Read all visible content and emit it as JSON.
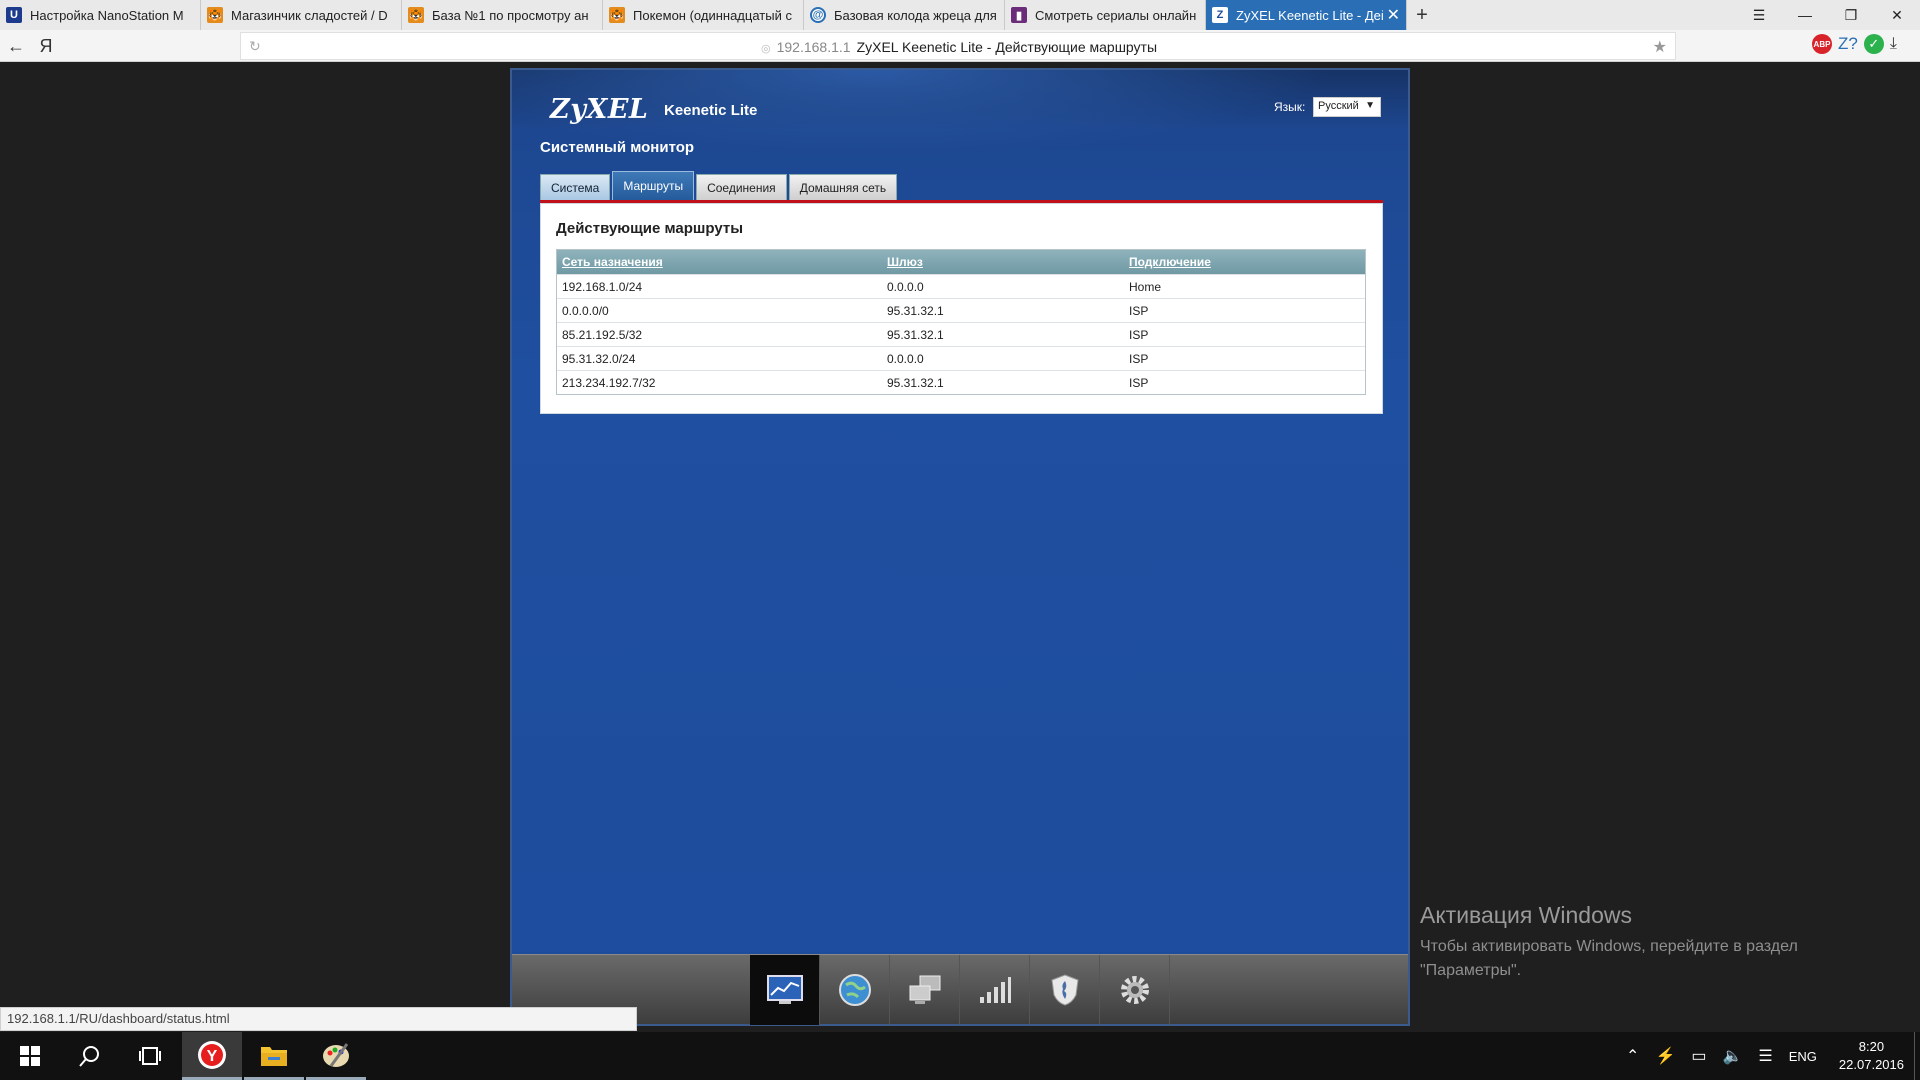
{
  "browser": {
    "tabs": [
      {
        "label": "Настройка NanoStation M",
        "icon": "ubiquiti-icon",
        "color": "#1d3b8c"
      },
      {
        "label": "Магазинчик сладостей / D",
        "icon": "tiger-icon",
        "color": "#e38b1c"
      },
      {
        "label": "База №1 по просмотру ан",
        "icon": "tiger-icon",
        "color": "#e38b1c"
      },
      {
        "label": "Покемон (одиннадцатый с",
        "icon": "tiger-icon",
        "color": "#e38b1c"
      },
      {
        "label": "Базовая колода жреца для",
        "icon": "spiral-icon",
        "color": "#2a6fb5"
      },
      {
        "label": "Смотреть сериалы онлайн",
        "icon": "book-icon",
        "color": "#6b2d7a"
      },
      {
        "label": "ZyXEL Keenetic Lite - Дей",
        "icon": "zyxel-icon",
        "color": "#1e4c9d"
      }
    ],
    "address": {
      "host": "192.168.1.1",
      "title": "ZyXEL Keenetic Lite - Действующие маршруты"
    },
    "status_url": "192.168.1.1/RU/dashboard/status.html"
  },
  "router": {
    "brand": "ZyXEL",
    "model": "Keenetic Lite",
    "language_label": "Язык:",
    "language_value": "Русский",
    "page_title": "Системный монитор",
    "tabs": [
      "Система",
      "Маршруты",
      "Соединения",
      "Домашняя сеть"
    ],
    "active_tab": "Маршруты",
    "panel_title": "Действующие маршруты",
    "table": {
      "headers": [
        "Сеть назначения",
        "Шлюз",
        "Подключение"
      ],
      "rows": [
        [
          "192.168.1.0/24",
          "0.0.0.0",
          "Home"
        ],
        [
          "0.0.0.0/0",
          "95.31.32.1",
          "ISP"
        ],
        [
          "85.21.192.5/32",
          "95.31.32.1",
          "ISP"
        ],
        [
          "95.31.32.0/24",
          "0.0.0.0",
          "ISP"
        ],
        [
          "213.234.192.7/32",
          "95.31.32.1",
          "ISP"
        ]
      ]
    },
    "nav_icons": [
      "monitor-chart-icon",
      "globe-icon",
      "network-computers-icon",
      "signal-bars-icon",
      "shield-icon",
      "gear-icon"
    ]
  },
  "windows_activation": {
    "title": "Активация Windows",
    "line1": "Чтобы активировать Windows, перейдите в раздел",
    "line2": "\"Параметры\"."
  },
  "taskbar": {
    "lang": "ENG",
    "time": "8:20",
    "date": "22.07.2016"
  },
  "colors": {
    "router_blue": "#1e4c9d",
    "tab_active": "#2a6fb5",
    "red_line": "#c0111a"
  }
}
